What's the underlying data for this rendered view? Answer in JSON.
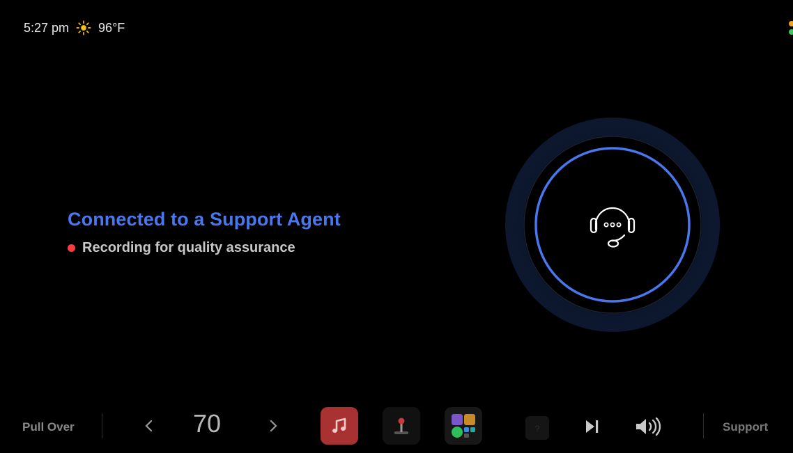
{
  "status": {
    "time": "5:27 pm",
    "weather_icon": "sun-icon",
    "temperature": "96°F"
  },
  "call": {
    "title": "Connected to a Support Agent",
    "subtitle": "Recording for quality assurance",
    "icon": "headset-agent-icon"
  },
  "dock": {
    "pull_over": "Pull Over",
    "speed": "70",
    "support": "Support",
    "apps": [
      "music-app-icon",
      "joystick-app-icon",
      "media-apps-folder-icon"
    ],
    "controls": [
      "skip-next-icon",
      "volume-icon"
    ]
  },
  "colors": {
    "accent": "#4a76ee",
    "recording": "#ff3b3b",
    "orb_glow": "#0b1426",
    "music_tile": "#e04b4b"
  }
}
